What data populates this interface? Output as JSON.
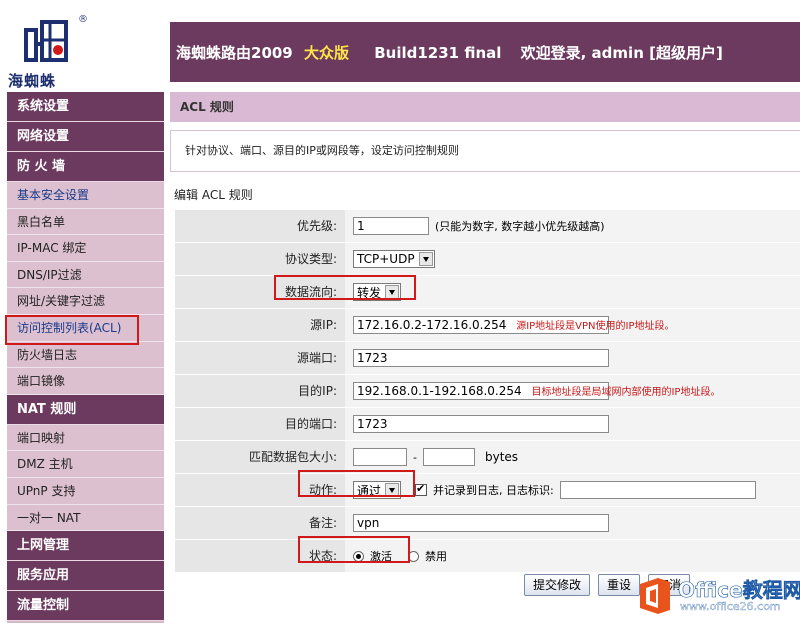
{
  "brand": {
    "logo_text": "海蜘蛛",
    "reg_mark": "®"
  },
  "header": {
    "product": "海蜘蛛路由2009",
    "edition": "大众版",
    "build": "Build1231 final",
    "welcome": "欢迎登录, admin [超级用户]",
    "bg_color": "#6b3a5e",
    "edition_color": "#ffe34a"
  },
  "sidebar": {
    "sections": [
      {
        "label": "系统设置",
        "items": []
      },
      {
        "label": "网络设置",
        "items": []
      },
      {
        "label": "防 火 墙",
        "items": [
          "基本安全设置",
          "黑白名单",
          "IP-MAC 绑定",
          "DNS/IP过滤",
          "网址/关键字过滤",
          "访问控制列表(ACL)",
          "防火墙日志",
          "端口镜像"
        ]
      },
      {
        "label": "NAT 规则",
        "items": [
          "端口映射",
          "DMZ 主机",
          "UPnP 支持",
          "一对一 NAT"
        ]
      },
      {
        "label": "上网管理",
        "items": []
      },
      {
        "label": "服务应用",
        "items": []
      },
      {
        "label": "流量控制",
        "items": []
      }
    ]
  },
  "page": {
    "title": "ACL 规则",
    "description": "针对协议、端口、源目的IP或网段等，设定访问控制规则",
    "edit_title": "编辑 ACL 规则"
  },
  "form": {
    "priority": {
      "label": "优先级:",
      "value": "1",
      "hint": "(只能为数字, 数字越小优先级越高)"
    },
    "protocol": {
      "label": "协议类型:",
      "value": "TCP+UDP"
    },
    "direction": {
      "label": "数据流向:",
      "value": "转发"
    },
    "src_ip": {
      "label": "源IP:",
      "value": "172.16.0.2-172.16.0.254",
      "note": "源IP地址段是VPN使用的IP地址段。"
    },
    "src_port": {
      "label": "源端口:",
      "value": "1723"
    },
    "dst_ip": {
      "label": "目的IP:",
      "value": "192.168.0.1-192.168.0.254",
      "note": "目标地址段是局域网内部使用的IP地址段。"
    },
    "dst_port": {
      "label": "目的端口:",
      "value": "1723"
    },
    "pkt_size": {
      "label": "匹配数据包大小:",
      "min": "",
      "dash": "-",
      "max": "",
      "unit": "bytes"
    },
    "action": {
      "label": "动作:",
      "value": "通过",
      "log_label": "并记录到日志, 日志标识:",
      "log_checked": true,
      "log_tag": ""
    },
    "remark": {
      "label": "备注:",
      "value": "vpn"
    },
    "status": {
      "label": "状态:",
      "options": [
        "激活",
        "禁用"
      ],
      "selected": "激活"
    }
  },
  "buttons": {
    "submit": "提交修改",
    "reset": "重设",
    "cancel": "取消"
  },
  "watermark": {
    "main": "Office教程网",
    "url": "www.office26.com"
  }
}
